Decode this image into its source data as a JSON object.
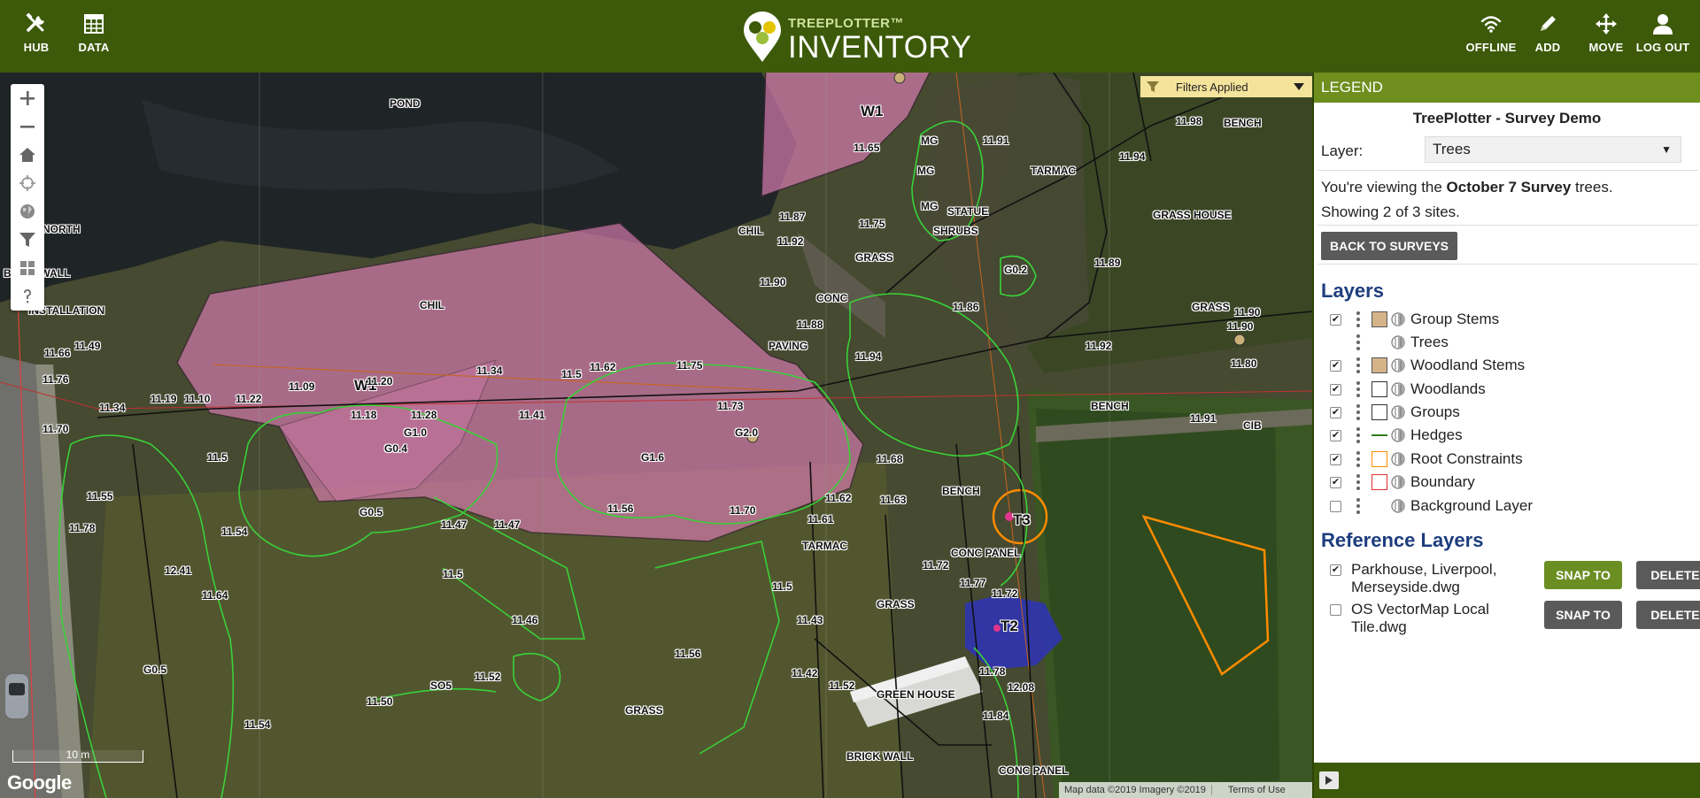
{
  "header": {
    "left_buttons": [
      {
        "label": "HUB",
        "icon": "tools-icon"
      },
      {
        "label": "DATA",
        "icon": "table-icon"
      }
    ],
    "logo": {
      "top": "TREEPLOTTER™",
      "main": "INVENTORY"
    },
    "right_buttons": [
      {
        "label": "OFFLINE",
        "icon": "wifi-icon"
      },
      {
        "label": "ADD",
        "icon": "pencil-icon"
      },
      {
        "label": "MOVE",
        "icon": "move-icon"
      },
      {
        "label": "LOG OUT",
        "icon": "user-icon"
      }
    ]
  },
  "map": {
    "filter_label": "Filters Applied",
    "scale_label": "10 m",
    "attribution": "Google",
    "credit": "Map data ©2019 Imagery ©2019",
    "terms": "Terms of Use",
    "labels": [
      {
        "t": "POND"
      },
      {
        "t": "W1"
      },
      {
        "t": "W1"
      },
      {
        "t": "T3"
      },
      {
        "t": "T2"
      },
      {
        "t": "BRICK WALL"
      },
      {
        "t": "INSTALLATION"
      },
      {
        "t": "NORTH"
      },
      {
        "t": "CHIL"
      },
      {
        "t": "CHIL"
      },
      {
        "t": "GRASS"
      },
      {
        "t": "CONC"
      },
      {
        "t": "PAVING"
      },
      {
        "t": "STATUE"
      },
      {
        "t": "SHRUBS"
      },
      {
        "t": "TARMAC"
      },
      {
        "t": "GRASS HOUSE"
      },
      {
        "t": "BENCH"
      },
      {
        "t": "BENCH"
      },
      {
        "t": "BENCH"
      },
      {
        "t": "GRASS"
      },
      {
        "t": "CONC PANEL"
      },
      {
        "t": "GRASS"
      },
      {
        "t": "GREEN HOUSE"
      },
      {
        "t": "GRASS"
      },
      {
        "t": "BRICK WALL"
      },
      {
        "t": "CONC PANEL"
      },
      {
        "t": "TARMAC"
      },
      {
        "t": "11.65"
      },
      {
        "t": "11.87"
      },
      {
        "t": "11.92"
      },
      {
        "t": "11.75"
      },
      {
        "t": "11.90"
      },
      {
        "t": "11.88"
      },
      {
        "t": "11.94"
      },
      {
        "t": "11.86"
      },
      {
        "t": "11.89"
      },
      {
        "t": "11.91"
      },
      {
        "t": "11.98"
      },
      {
        "t": "11.94"
      },
      {
        "t": "11.62"
      },
      {
        "t": "11.75"
      },
      {
        "t": "11.73"
      },
      {
        "t": "11.70"
      },
      {
        "t": "11.56"
      },
      {
        "t": "11.34"
      },
      {
        "t": "11.09"
      },
      {
        "t": "11.20"
      },
      {
        "t": "11.18"
      },
      {
        "t": "11.28"
      },
      {
        "t": "11.41"
      },
      {
        "t": "11.47"
      },
      {
        "t": "11.47"
      },
      {
        "t": "11.5"
      },
      {
        "t": "11.46"
      },
      {
        "t": "11.52"
      },
      {
        "t": "11.50"
      },
      {
        "t": "11.54"
      },
      {
        "t": "11.56"
      },
      {
        "t": "11.5"
      },
      {
        "t": "11.43"
      },
      {
        "t": "11.42"
      },
      {
        "t": "11.52"
      },
      {
        "t": "11.62"
      },
      {
        "t": "11.61"
      },
      {
        "t": "11.63"
      },
      {
        "t": "11.68"
      },
      {
        "t": "11.72"
      },
      {
        "t": "11.77"
      },
      {
        "t": "11.72"
      },
      {
        "t": "11.78"
      },
      {
        "t": "12.08"
      },
      {
        "t": "11.84"
      },
      {
        "t": "11.90"
      },
      {
        "t": "11.92"
      },
      {
        "t": "11.90"
      },
      {
        "t": "11.80"
      },
      {
        "t": "11.91"
      },
      {
        "t": "MG"
      },
      {
        "t": "MG"
      },
      {
        "t": "MG"
      },
      {
        "t": "G0.2"
      },
      {
        "t": "G0.4"
      },
      {
        "t": "G1.0"
      },
      {
        "t": "G1.6"
      },
      {
        "t": "G2.0"
      },
      {
        "t": "G0.5"
      },
      {
        "t": "G0.5"
      },
      {
        "t": "SO5"
      },
      {
        "t": "CIB"
      },
      {
        "t": "11.70"
      },
      {
        "t": "11.76"
      },
      {
        "t": "11.66"
      },
      {
        "t": "11.49"
      },
      {
        "t": "11.55"
      },
      {
        "t": "11.78"
      },
      {
        "t": "12.41"
      },
      {
        "t": "11.64"
      },
      {
        "t": "11.54"
      },
      {
        "t": "11.5"
      },
      {
        "t": "11.22"
      },
      {
        "t": "11.10"
      },
      {
        "t": "11.19"
      },
      {
        "t": "11.34"
      },
      {
        "t": "11.5"
      }
    ]
  },
  "legend": {
    "header": "LEGEND",
    "title": "TreePlotter - Survey Demo",
    "layer_label": "Layer:",
    "layer_value": "Trees",
    "viewing_prefix": "You're viewing the ",
    "viewing_bold": "October 7 Survey",
    "viewing_suffix": " trees.",
    "showing": "Showing 2 of 3 sites.",
    "back_button": "BACK TO SURVEYS",
    "layers_title": "Layers",
    "layers": [
      {
        "name": "Group Stems",
        "checked": true,
        "swatch": "fill"
      },
      {
        "name": "Trees",
        "checked": null,
        "swatch": "none"
      },
      {
        "name": "Woodland Stems",
        "checked": true,
        "swatch": "fill"
      },
      {
        "name": "Woodlands",
        "checked": true,
        "swatch": "box-dark"
      },
      {
        "name": "Groups",
        "checked": true,
        "swatch": "box-dark"
      },
      {
        "name": "Hedges",
        "checked": true,
        "swatch": "line-green"
      },
      {
        "name": "Root Constraints",
        "checked": true,
        "swatch": "box-orange"
      },
      {
        "name": "Boundary",
        "checked": true,
        "swatch": "box-red"
      },
      {
        "name": "Background Layer",
        "checked": false,
        "swatch": "none"
      }
    ],
    "ref_title": "Reference Layers",
    "ref_layers": [
      {
        "name": "Parkhouse, Liverpool, Merseyside.dwg",
        "checked": true,
        "snap": "SNAP TO",
        "snap_active": true,
        "delete": "DELETE"
      },
      {
        "name": "OS VectorMap Local Tile.dwg",
        "checked": false,
        "snap": "SNAP TO",
        "snap_active": false,
        "delete": "DELETE"
      }
    ]
  },
  "colors": {
    "header_bg": "#3c5a09",
    "legend_head": "#6e8e1e",
    "snap_active": "#6b8e23",
    "snap_inactive": "#5a5a5a",
    "woodland_fill": "#d77bb0",
    "hedge": "#33cc33",
    "constraint": "#ff8c00",
    "section_title": "#1d3d7e"
  }
}
